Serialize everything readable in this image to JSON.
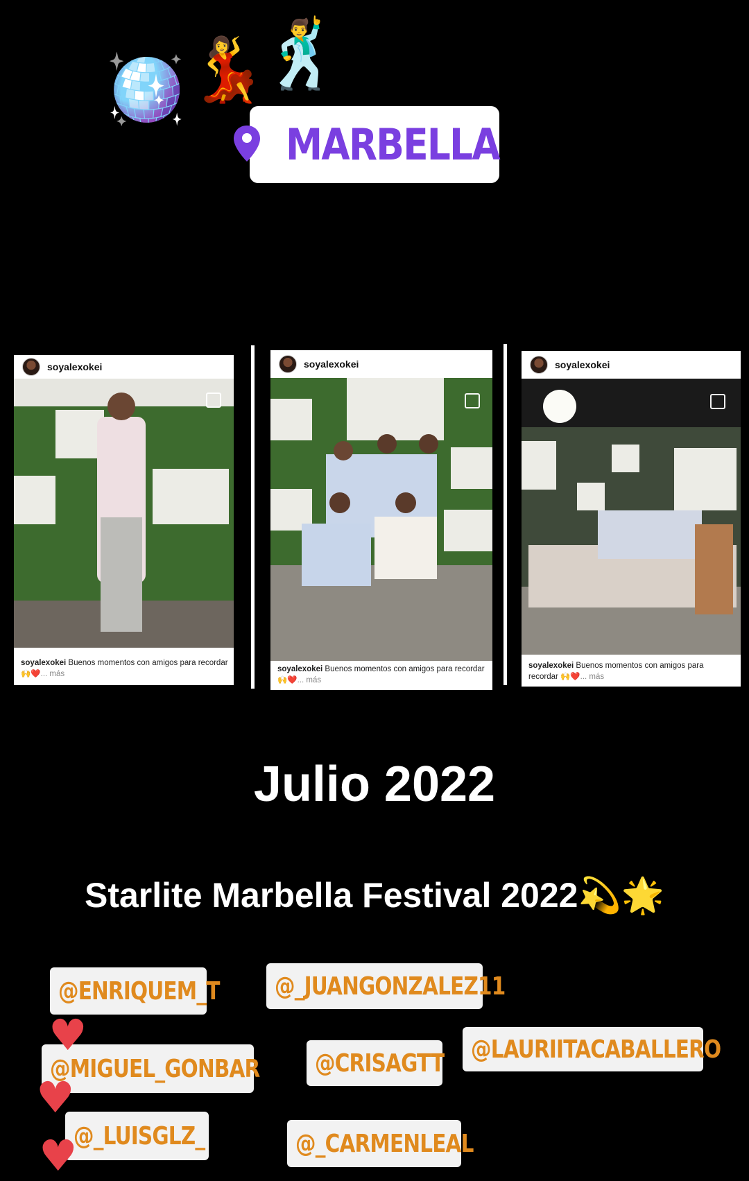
{
  "stickers": {
    "emojis": {
      "disco_ball": "🪩",
      "dancer_woman": "💃",
      "dancer_man": "🕺"
    },
    "location": {
      "icon": "location-pin-icon",
      "label": "MARBELLA",
      "color": "#7a3fe0"
    }
  },
  "posts": [
    {
      "user": "soyalexokei",
      "caption_user": "soyalexokei",
      "caption_text": "Buenos momentos con amigos para recordar 🙌❤️",
      "more": "... más"
    },
    {
      "user": "soyalexokei",
      "caption_user": "soyalexokei",
      "caption_text": "Buenos momentos con amigos para recordar 🙌❤️",
      "more": "... más"
    },
    {
      "user": "soyalexokei",
      "caption_user": "soyalexokei",
      "caption_text": "Buenos momentos con amigos para recordar 🙌❤️",
      "more": "... más"
    }
  ],
  "date_title": "Julio 2022",
  "event_title": "Starlite Marbella Festival 2022💫🌟",
  "mentions": [
    "@ENRIQUEM_T",
    "@_JUANGONZALEZ11",
    "@MIGUEL_GONBAR",
    "@CRISAGTT",
    "@LAURIITACABALLERO",
    "@_LUISGLZ_",
    "@_CARMENLEAL"
  ],
  "colors": {
    "mention_text": "#e08a1e",
    "heart": "#e8424a",
    "background": "#000000"
  }
}
